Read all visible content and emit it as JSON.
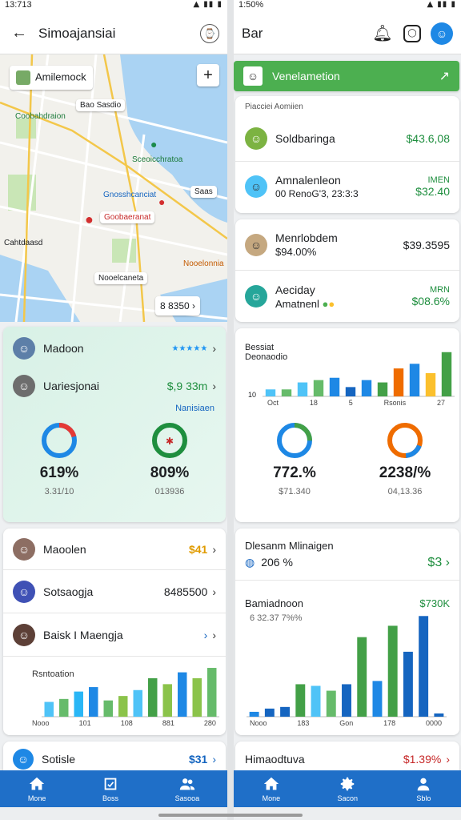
{
  "left": {
    "status_time": "13:713",
    "title": "Simoajansiai",
    "map": {
      "search_chip": "Amilemock",
      "labels": [
        "Bao Sasdio",
        "Coobahdraion",
        "Sceoicchratoa",
        "Gnosshcanciat",
        "Saas",
        "Goobaeranat",
        "Cahtdaasd",
        "Nooelonnia",
        "Nooelcaneta"
      ],
      "price_chip": "8 8350"
    },
    "stats_card": {
      "rows": [
        {
          "name": "Madoon",
          "stars": "★★★★★"
        },
        {
          "name": "Uariesjonai",
          "value": "$,9 33m"
        }
      ],
      "link": "Nanisiaen",
      "donuts": [
        {
          "pct": "619%",
          "sub": "3.31/10"
        },
        {
          "pct": "809%",
          "sub": "013936"
        }
      ]
    },
    "list_card": {
      "rows": [
        {
          "name": "Maoolen",
          "value": "$41"
        },
        {
          "name": "Sotsaogja",
          "value": "8485500"
        },
        {
          "name": "Baisk I Maengja",
          "value": ""
        }
      ],
      "chart_title": "Rsntoation",
      "chart_ticks": [
        "Nooo",
        "101",
        "108",
        "881",
        "280"
      ]
    },
    "bottom_card": {
      "name": "Sotisle",
      "value": "$31"
    },
    "nav": [
      {
        "label": "Mone",
        "icon": "home-icon"
      },
      {
        "label": "Boss",
        "icon": "checkbox-icon"
      },
      {
        "label": "Sasooa",
        "icon": "people-icon"
      }
    ]
  },
  "right": {
    "status_time": "1:50%",
    "title": "Bar",
    "banner": "Venelametion",
    "card1": {
      "header": "Piacciei Aomiien",
      "rows": [
        {
          "name": "Soldbaringa",
          "sub": "",
          "value": "$43.6,08",
          "vsub": ""
        },
        {
          "name": "Amnalenleon",
          "sub": "00 RenoG'3, 23:3:3",
          "value": "IMEN",
          "vsub": "$32.40"
        }
      ]
    },
    "card2": {
      "rows": [
        {
          "name": "Menrlobdem",
          "sub": "$94.00%",
          "value": "$39.3595",
          "vsub": ""
        },
        {
          "name": "Aeciday",
          "sub": "Amatnenl",
          "value": "MRN",
          "vsub": "$08.6%"
        }
      ]
    },
    "chart_card": {
      "title": "Bessiat",
      "subtitle": "Deonaodio",
      "xticks": [
        "Oct",
        "18",
        "5",
        "Rsonis",
        "27"
      ],
      "yzero": "10",
      "donuts": [
        {
          "pct": "772.%",
          "sub": "$71.340"
        },
        {
          "pct": "2238/%",
          "sub": "04,13.36"
        }
      ]
    },
    "growth_card": {
      "title": "Dlesanm Mlinaigen",
      "pct": "206 %",
      "value": "$3",
      "sub_title": "Bamiadnoon",
      "sub_value": "$730K",
      "sub_line": "6 32.37 7%%",
      "xticks": [
        "Nooo",
        "183",
        "Gon",
        "178",
        "0000"
      ]
    },
    "bottom_card": {
      "name": "Himaodtuva",
      "value": "$1.39%"
    },
    "nav": [
      {
        "label": "Mone",
        "icon": "home-icon"
      },
      {
        "label": "Sacon",
        "icon": "gear-icon"
      },
      {
        "label": "Sblo",
        "icon": "person-icon"
      }
    ]
  },
  "chart_data": [
    {
      "type": "bar",
      "title": "Rsntoation",
      "categories": [
        "Nooo",
        "",
        "",
        "",
        "101",
        "",
        "",
        "108",
        "",
        "881",
        "",
        "280"
      ],
      "series": [
        {
          "values": [
            10,
            12,
            17,
            20,
            11,
            14,
            18,
            26,
            22,
            30,
            26,
            33
          ]
        }
      ]
    },
    {
      "type": "bar",
      "title": "Bessiat",
      "categories": [
        "Oct",
        "",
        "",
        "18",
        "",
        "",
        "5",
        "",
        "",
        "Rsonis",
        "",
        "27"
      ],
      "series": [
        {
          "values": [
            3,
            3,
            6,
            7,
            8,
            4,
            7,
            6,
            12,
            14,
            10,
            19
          ]
        }
      ]
    },
    {
      "type": "bar",
      "title": "Bamiadnoon",
      "categories": [
        "Nooo",
        "",
        "183",
        "",
        "Gon",
        "",
        "",
        "178",
        "",
        "0000"
      ],
      "series": [
        {
          "values": [
            3,
            5,
            6,
            20,
            19,
            16,
            20,
            49,
            22,
            56,
            40,
            62,
            2
          ]
        }
      ]
    }
  ]
}
